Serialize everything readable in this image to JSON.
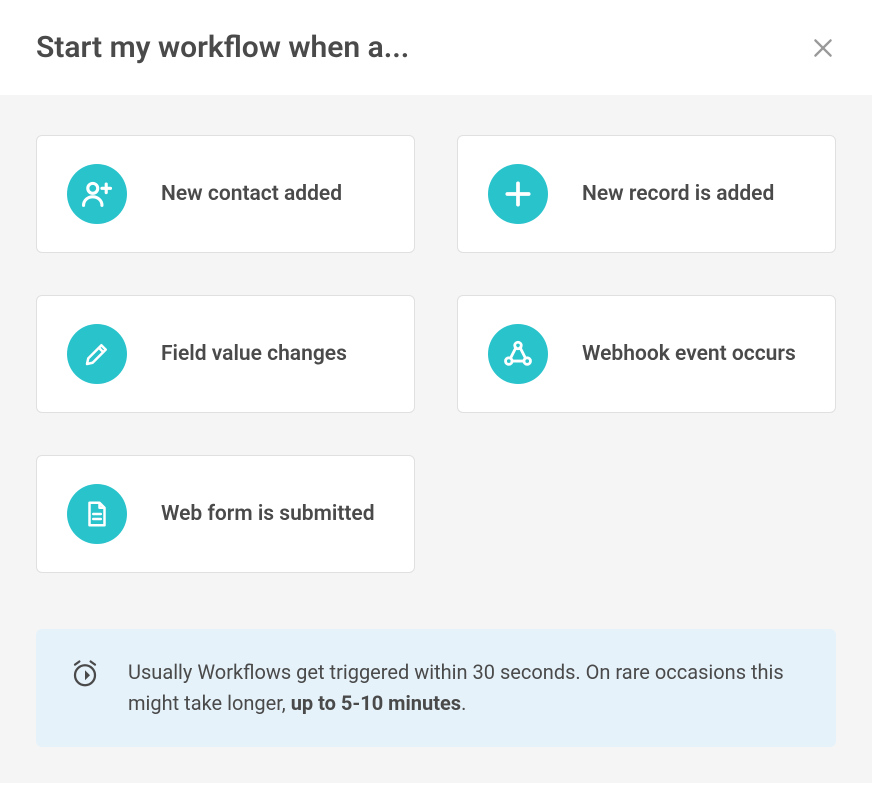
{
  "header": {
    "title": "Start my workflow when a..."
  },
  "triggers": [
    {
      "icon": "person-add-icon",
      "label": "New contact added"
    },
    {
      "icon": "plus-icon",
      "label": "New record is added"
    },
    {
      "icon": "pencil-icon",
      "label": "Field value changes"
    },
    {
      "icon": "webhook-icon",
      "label": "Webhook event occurs"
    },
    {
      "icon": "document-icon",
      "label": "Web form is submitted"
    }
  ],
  "info": {
    "text_prefix": "Usually Workflows get triggered within 30 seconds. On rare occasions this might take longer, ",
    "text_bold": "up to 5-10 minutes",
    "text_suffix": "."
  }
}
